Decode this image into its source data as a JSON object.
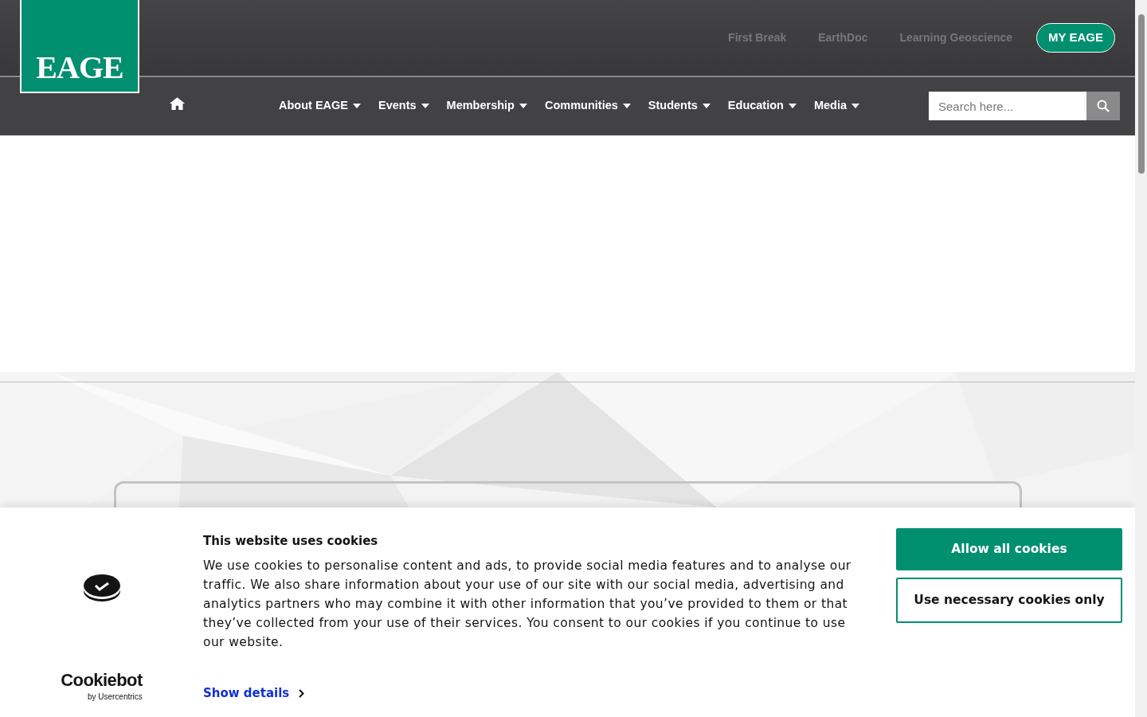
{
  "logo": {
    "text": "EAGE"
  },
  "top_links": [
    {
      "label": "First Break"
    },
    {
      "label": "EarthDoc"
    },
    {
      "label": "Learning Geoscience"
    }
  ],
  "account_button": {
    "label": "MY EAGE"
  },
  "nav": [
    {
      "label": "About EAGE",
      "has_dropdown": true
    },
    {
      "label": "Events",
      "has_dropdown": true
    },
    {
      "label": "Membership",
      "has_dropdown": true
    },
    {
      "label": "Communities",
      "has_dropdown": true
    },
    {
      "label": "Students",
      "has_dropdown": true
    },
    {
      "label": "Education",
      "has_dropdown": true
    },
    {
      "label": "Media",
      "has_dropdown": true
    }
  ],
  "search": {
    "placeholder": "Search here..."
  },
  "banner_card": {
    "kind": "outlined"
  },
  "cookie_banner": {
    "brand": "Cookiebot",
    "brand_sub": "by Usercentrics",
    "title": "This website uses cookies",
    "body": "We use cookies to personalise content and ads, to provide social media features and to analyse our traffic. We also share information about your use of our site with our social media, advertising and analytics partners who may combine it with other information that you’ve provided to them or that they’ve collected from your use of their services. You consent to our cookies if you continue to use our website.",
    "details_link": "Show details",
    "buttons": [
      {
        "label": "Allow all cookies",
        "kind": "primary"
      },
      {
        "label": "Use necessary cookies only",
        "kind": "outline"
      }
    ]
  }
}
